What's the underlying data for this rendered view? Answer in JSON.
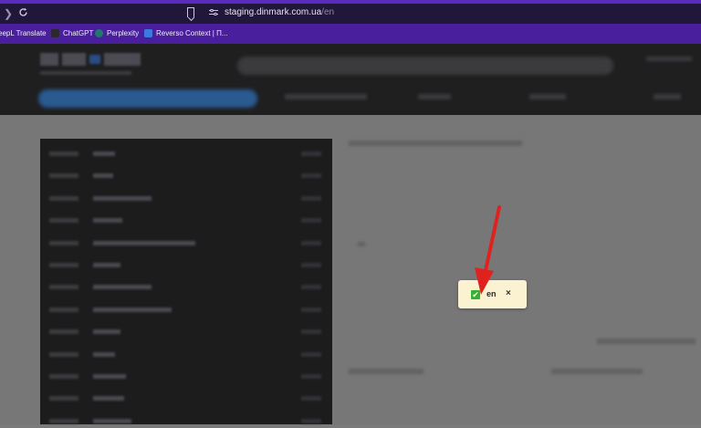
{
  "browser": {
    "url_host": "staging.dinmark.com.ua",
    "url_path": "/en",
    "bookmarks": [
      {
        "label": "eepL Translate",
        "icon_color": "#1b2b4a"
      },
      {
        "label": "ChatGPT",
        "icon_color": "#2a2a2a"
      },
      {
        "label": "Perplexity",
        "icon_color": "#1e7a6e"
      },
      {
        "label": "Reverso Context | П...",
        "icon_color": "#3b7be0"
      }
    ]
  },
  "toast": {
    "check_glyph": "✔",
    "language": "en",
    "close_glyph": "×"
  },
  "colors": {
    "annotation_arrow": "#e0221f",
    "toast_bg": "#fbf2d2",
    "check_green": "#35b12f"
  }
}
